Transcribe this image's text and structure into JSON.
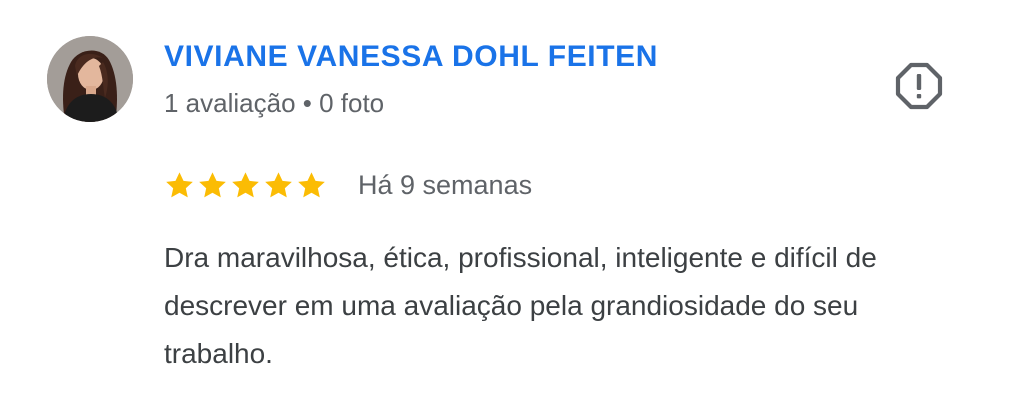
{
  "reviewer": {
    "name": "VIVIANE VANESSA DOHL FEITEN",
    "meta": "1 avaliação • 0 foto",
    "avatar_icon": "profile-photo"
  },
  "review": {
    "rating": 5,
    "rating_max": 5,
    "date": "Há 9 semanas",
    "text": "Dra maravilhosa, ética, profissional, inteligente e difícil de descrever em uma avaliação pela grandiosidade do seu trabalho."
  },
  "actions": {
    "report_icon": "report-icon"
  },
  "colors": {
    "name": "#1a73e8",
    "star": "#fbbc04",
    "meta": "#5f6368",
    "text": "#3c4043"
  }
}
